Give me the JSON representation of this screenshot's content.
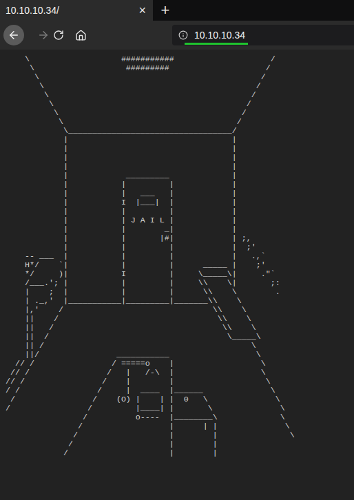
{
  "tab": {
    "title": "10.10.10.34/",
    "close": "×",
    "selected": true
  },
  "new_tab": "+",
  "toolbar": {
    "back": {
      "hovered": true,
      "disabled": false
    },
    "forward": {
      "disabled": true
    }
  },
  "address_bar": {
    "url": "10.10.10.34",
    "highlighted": true
  },
  "page": {
    "art": [
      "    \\                   ###########                    /",
      "     \\                   #########                    /",
      "      \\                                              /",
      "       \\                                            /",
      "        \\                                          /",
      "         \\                                        /",
      "          \\                                      /",
      "           \\                                    /",
      "            \\__________________________________/",
      "            |                                  |",
      "            |                                  |",
      "            |                                  |",
      "            |                                  |",
      "            |            _________             |",
      "            |           |         |            |",
      "            |           |   ___   |            |",
      "            |           I  |___|  |            |",
      "            |           |         |            |",
      "            |           | J A I L |            |",
      "            |           |        _|            |",
      "            |           |       |#|            | ;,",
      "            |           |         |            |  ;'",
      "    -- ___  |           |         |            |   .,`",
      "    H*/    `|           |         |      _____ |    ;'",
      "    */     )|           I         |     \\_____\\|     .\"`",
      "    /___.'; |           |         |     \\\\    \\|       ;:",
      "    |    ;  |           |         |      \\\\    \\        .",
      "    | ._,'  |___________|_________|_______\\\\    \\",
      "    |,'    /                               \\\\    \\",
      "    ||    /                                 \\\\    \\",
      "    ||   /                                   \\\\    \\",
      "    ||  /                                     \\_____\\",
      "    || /                                           \\",
      "    ||/                ___________                  \\",
      "  // /                / =====o    |                  \\",
      " // /                /   |   /-\\  |                  \\",
      "// /                /    |        |                   \\",
      "/ /                /     |  ____  |______              \\",
      " /                /    (O) |    | |  0   \\              \\",
      "/                /         |____| |       \\              \\",
      "                /          o----  |________\\             \\",
      "               /                  |      | |              \\",
      "              /                   |        |               \\",
      "             /                    |        |",
      "            /                     |        |"
    ]
  }
}
